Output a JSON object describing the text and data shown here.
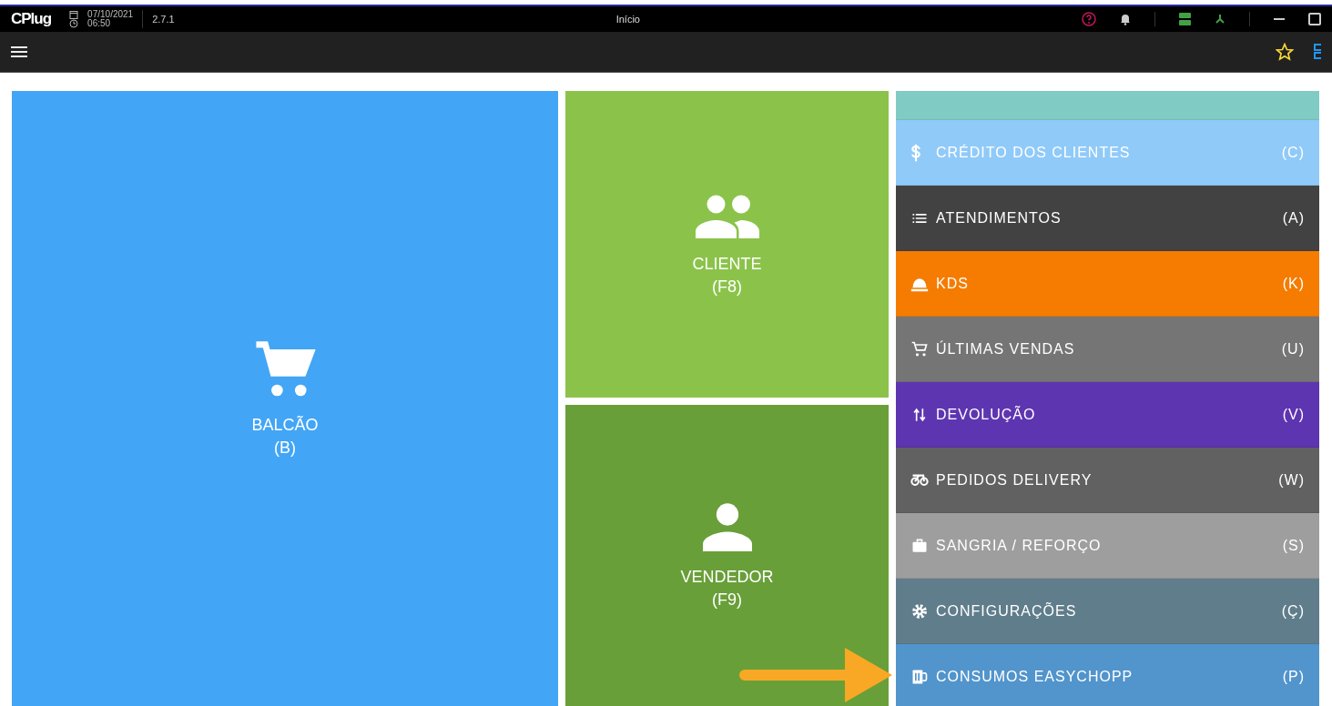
{
  "top_bar": {
    "logo": "CPlug",
    "date": "07/10/2021",
    "time": "06:50",
    "version": "2.7.1",
    "title": "Início"
  },
  "tiles": [
    {
      "label": "BALCÃO",
      "shortcut": "(B)",
      "color": "#42a5f5"
    },
    {
      "label": "CLIENTE",
      "shortcut": "(F8)",
      "color": "#8bc34a"
    },
    {
      "label": "VENDEDOR",
      "shortcut": "(F9)",
      "color": "#689f38"
    }
  ],
  "menu": [
    {
      "kind": "partial",
      "color": "#80cbc4"
    },
    {
      "kind": "item",
      "label": "CRÉDITO DOS CLIENTES",
      "shortcut": "(C)",
      "color": "#90caf9"
    },
    {
      "kind": "item",
      "label": "ATENDIMENTOS",
      "shortcut": "(A)",
      "color": "#424242"
    },
    {
      "kind": "item",
      "label": "KDS",
      "shortcut": "(K)",
      "color": "#f57c00"
    },
    {
      "kind": "item",
      "label": "ÚLTIMAS VENDAS",
      "shortcut": "(U)",
      "color": "#757575"
    },
    {
      "kind": "item",
      "label": "DEVOLUÇÃO",
      "shortcut": "(V)",
      "color": "#5e35b1"
    },
    {
      "kind": "item",
      "label": "PEDIDOS DELIVERY",
      "shortcut": "(W)",
      "color": "#616161"
    },
    {
      "kind": "item",
      "label": "SANGRIA / REFORÇO",
      "shortcut": "(S)",
      "color": "#9e9e9e"
    },
    {
      "kind": "item",
      "label": "CONFIGURAÇÕES",
      "shortcut": "(Ç)",
      "color": "#607d8b"
    },
    {
      "kind": "item",
      "label": "CONSUMOS EASYCHOPP",
      "shortcut": "(P)",
      "color": "#5294cc"
    }
  ]
}
